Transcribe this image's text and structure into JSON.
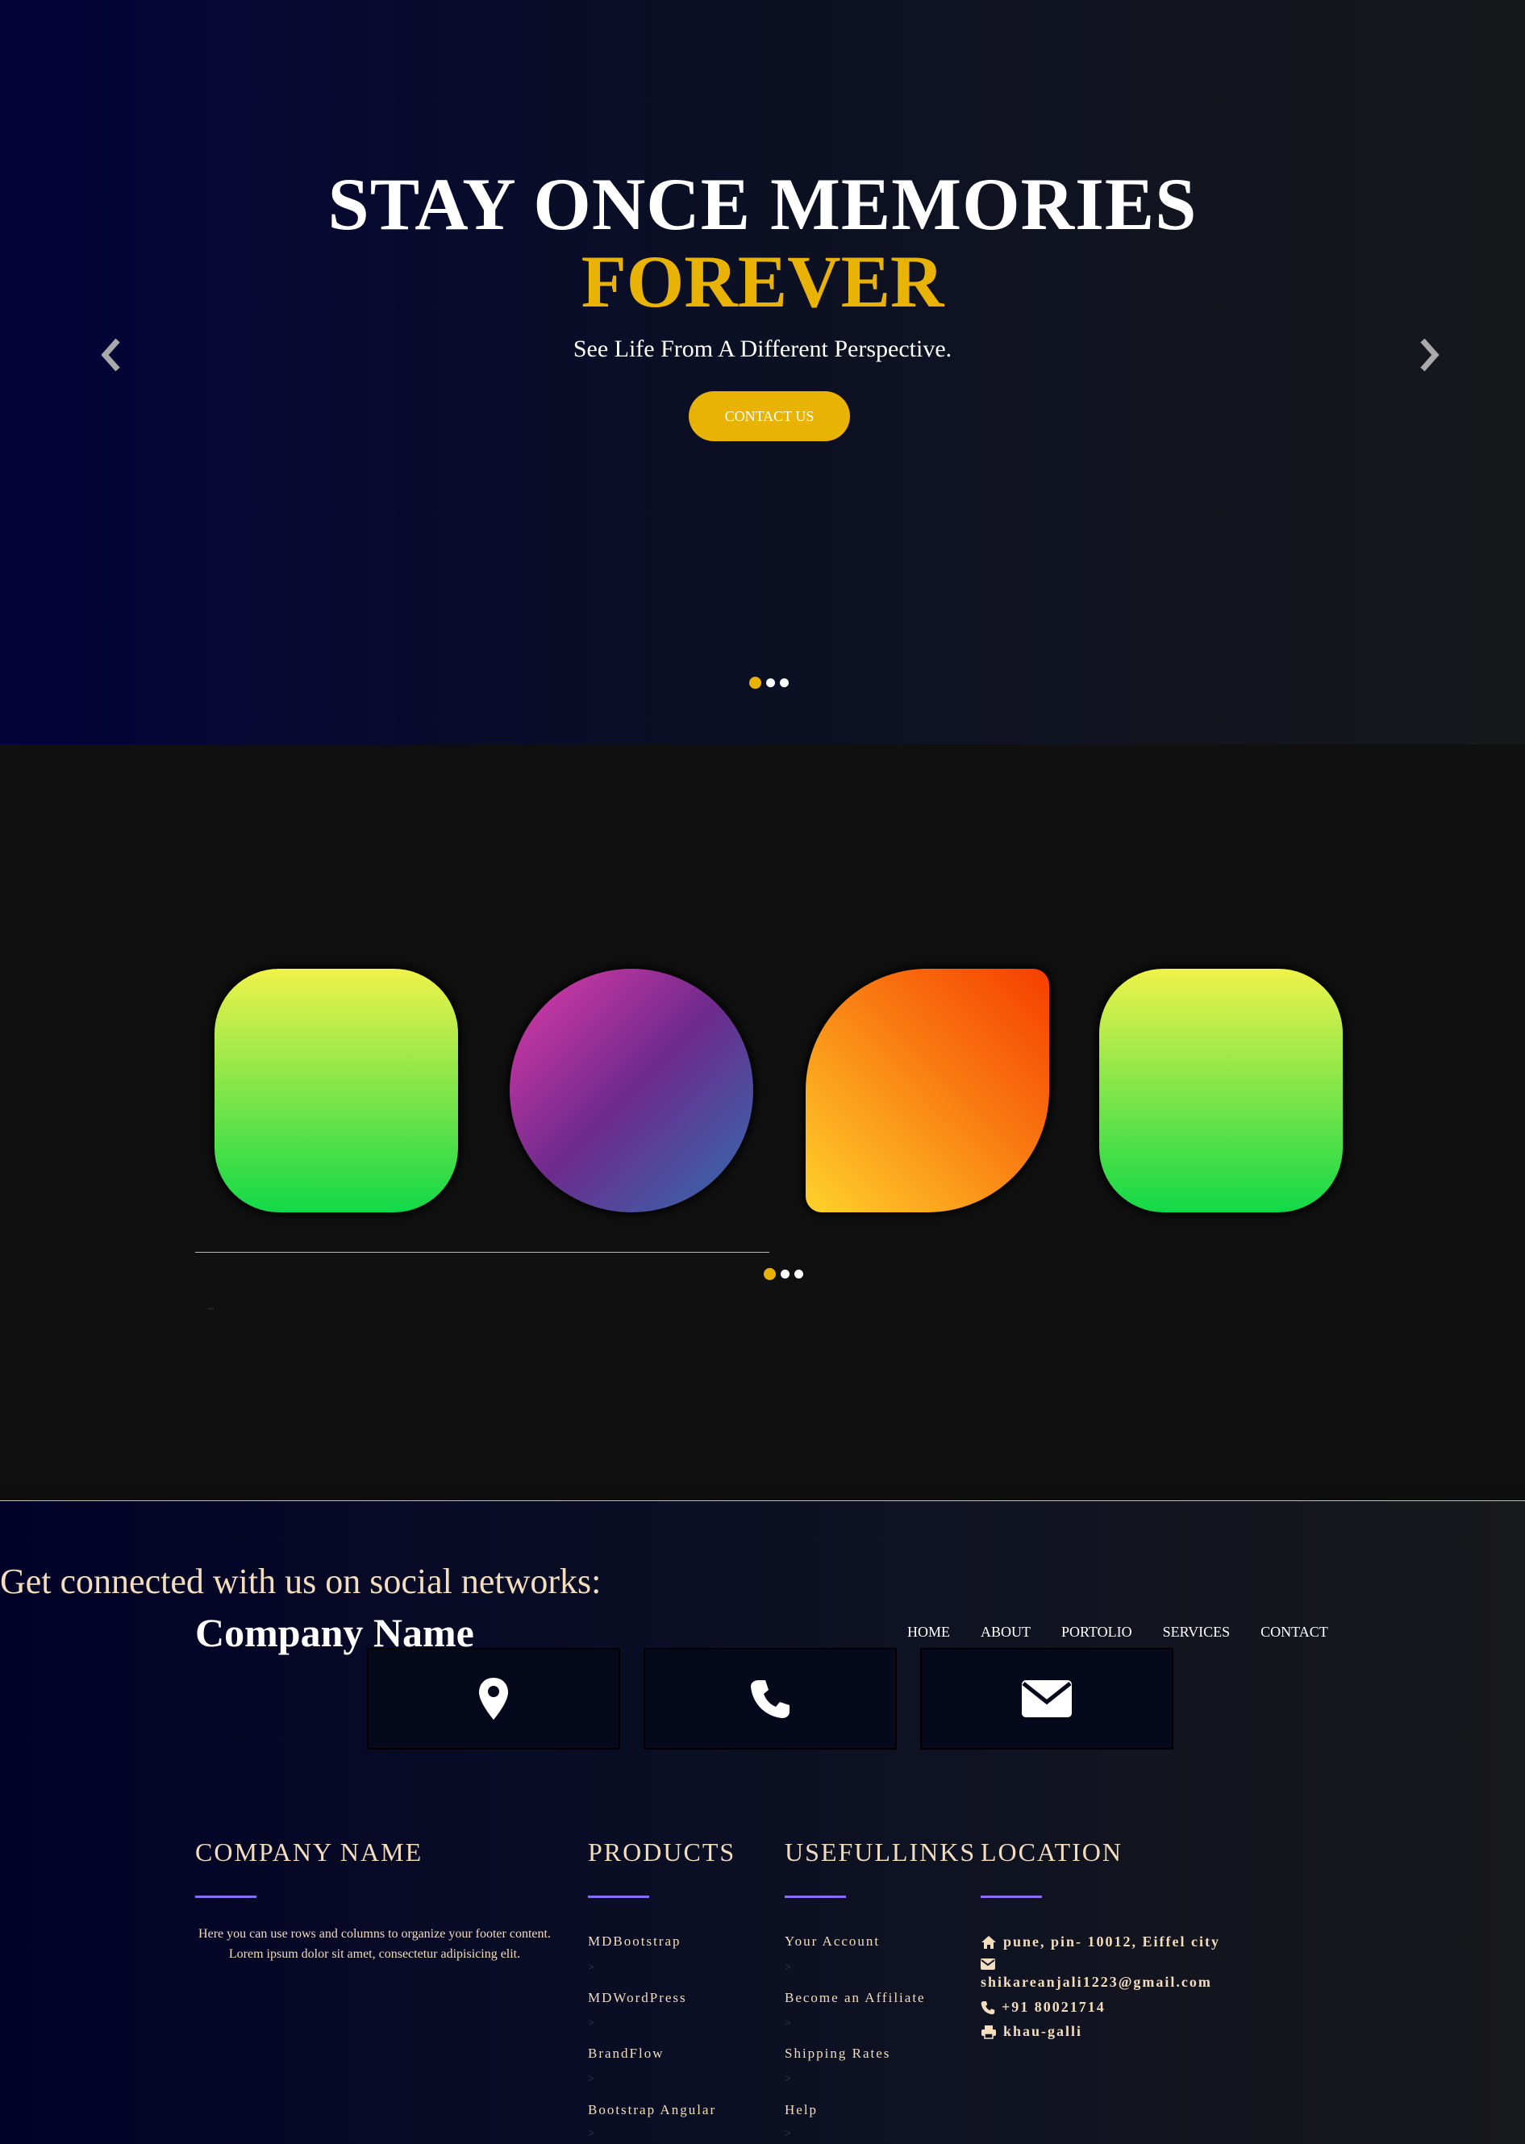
{
  "hero": {
    "title_line1": "STAY ONCE MEMORIES",
    "title_line2": "FOREVER",
    "subtitle": "See Life From A Different Perspective.",
    "cta_label": "CONTACT US",
    "slides": 3,
    "active_slide": 1
  },
  "shapes_section": {
    "shapes": [
      "rounded-square-green",
      "circle-purple",
      "leaf-orange",
      "rounded-square-green"
    ],
    "caption": "...",
    "slides": 3,
    "active_slide": 1
  },
  "contact_strip": {
    "social_heading": "Get connected with us on social networks:",
    "company_name": "Company Name",
    "nav": [
      "HOME",
      "ABOUT",
      "PORTOLIO",
      "SERVICES",
      "CONTACT"
    ],
    "boxes": [
      {
        "icon": "location-pin-icon"
      },
      {
        "icon": "phone-icon"
      },
      {
        "icon": "envelope-icon"
      }
    ]
  },
  "footer": {
    "company": {
      "heading": "COMPANY NAME",
      "text": "Here you can use rows and columns to organize your footer content. Lorem ipsum dolor sit amet, consectetur adipisicing elit."
    },
    "products": {
      "heading": "PRODUCTS",
      "links": [
        "MDBootstrap",
        "MDWordPress",
        "BrandFlow",
        "Bootstrap Angular"
      ],
      "separator": ">"
    },
    "useful": {
      "heading": "USEFULLINKS",
      "links": [
        "Your Account",
        "Become an Affiliate",
        "Shipping Rates",
        "Help"
      ],
      "separator": ">"
    },
    "location": {
      "heading": "LOCATION",
      "address": "pune, pin- 10012, Eiffel city",
      "email": "shikareanjali1223@gmail.com",
      "phone": "+91 80021714",
      "fax": "khau-galli"
    }
  },
  "colors": {
    "accent": "#e9b306",
    "heading_cream": "#f3ddbd",
    "footer_bar": "#8a6cf5"
  }
}
